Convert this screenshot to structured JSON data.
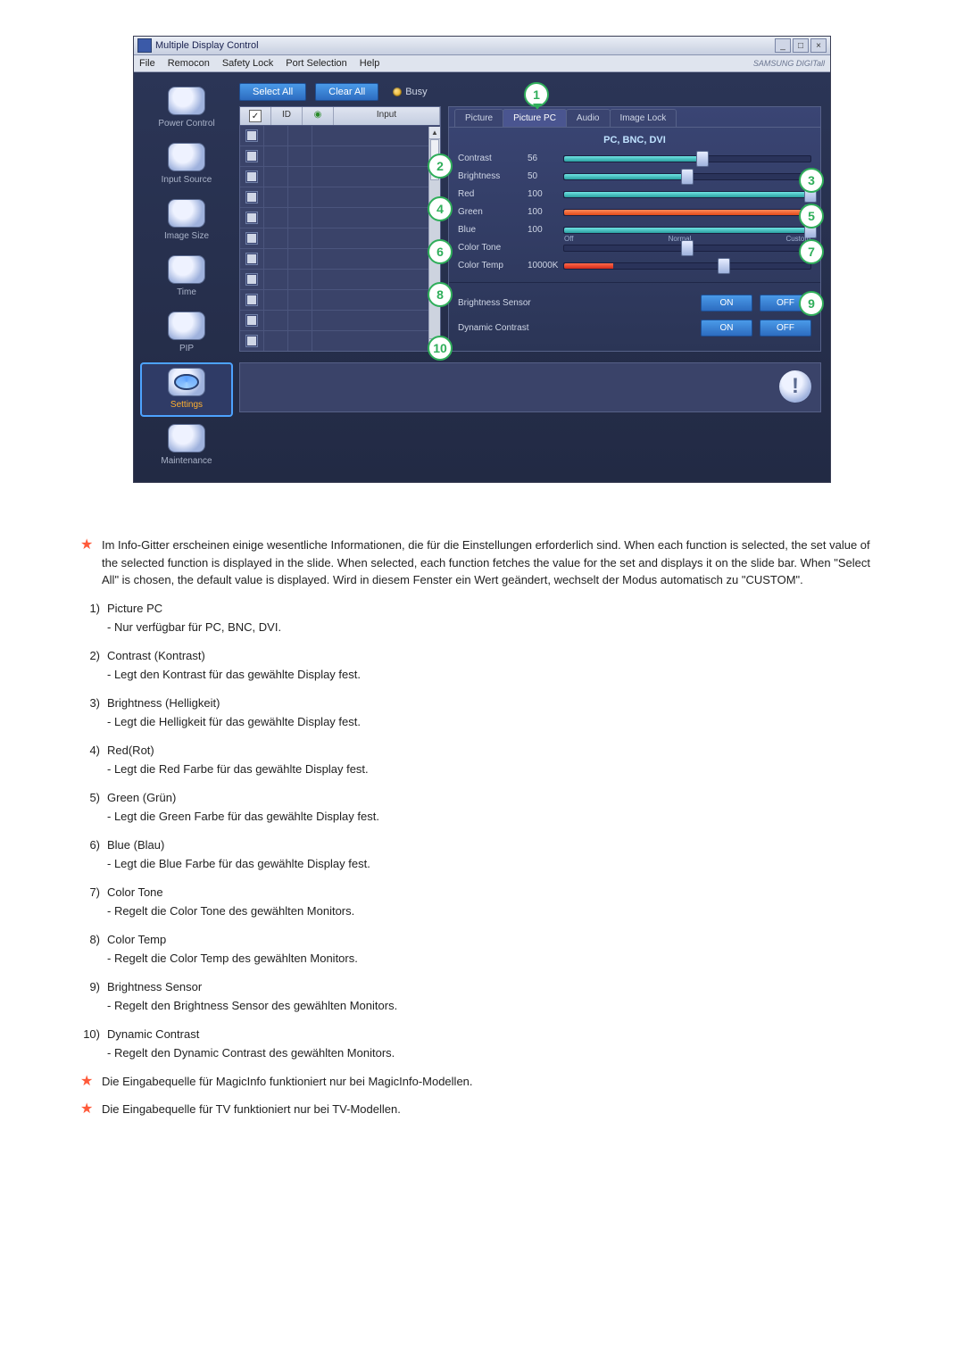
{
  "window": {
    "title": "Multiple Display Control",
    "min_icon": "_",
    "max_icon": "□",
    "close_icon": "×"
  },
  "menubar": {
    "file": "File",
    "remocon": "Remocon",
    "safety_lock": "Safety Lock",
    "port_selection": "Port Selection",
    "help": "Help",
    "brand": "SAMSUNG DIGITall"
  },
  "sidebar": {
    "items": [
      {
        "label": "Power Control"
      },
      {
        "label": "Input Source"
      },
      {
        "label": "Image Size"
      },
      {
        "label": "Time"
      },
      {
        "label": "PIP"
      },
      {
        "label": "Settings"
      },
      {
        "label": "Maintenance"
      }
    ]
  },
  "toolbar": {
    "select_all": "Select All",
    "clear_all": "Clear All",
    "busy": "Busy"
  },
  "grid": {
    "head_check": "✓",
    "head_id": "ID",
    "head_icon": "◉",
    "head_input": "Input",
    "row_count": 11
  },
  "panel": {
    "tabs": {
      "picture": "Picture",
      "picture_pc": "Picture PC",
      "audio": "Audio",
      "image_lock": "Image Lock"
    },
    "mode": "PC, BNC, DVI",
    "contrast": {
      "label": "Contrast",
      "value": "56"
    },
    "brightness": {
      "label": "Brightness",
      "value": "50"
    },
    "red": {
      "label": "Red",
      "value": "100"
    },
    "green": {
      "label": "Green",
      "value": "100"
    },
    "blue": {
      "label": "Blue",
      "value": "100"
    },
    "color_tone": {
      "label": "Color Tone",
      "ticks": {
        "off": "Off",
        "normal": "Normal",
        "custom": "Custom"
      }
    },
    "color_temp": {
      "label": "Color Temp",
      "value": "10000K"
    },
    "bsensor": {
      "label": "Brightness Sensor",
      "on": "ON",
      "off": "OFF"
    },
    "dcontrast": {
      "label": "Dynamic Contrast",
      "on": "ON",
      "off": "OFF"
    }
  },
  "callouts": {
    "c1": "1",
    "c2": "2",
    "c3": "3",
    "c4": "4",
    "c5": "5",
    "c6": "6",
    "c7": "7",
    "c8": "8",
    "c9": "9",
    "c10": "10"
  },
  "warn_glyph": "!",
  "doc": {
    "intro": "Im Info-Gitter erscheinen einige wesentliche Informationen, die für die Einstellungen erforderlich sind. When each function is selected, the set value of the selected function is displayed in the slide. When selected, each function fetches the value for the set and displays it on the slide bar. When \"Select All\" is chosen, the default value is displayed. Wird in diesem Fenster ein Wert geändert, wechselt der Modus automatisch zu \"CUSTOM\".",
    "i1_n": "1)",
    "i1_t": "Picture PC",
    "i1_s": "- Nur verfügbar für PC, BNC, DVI.",
    "i2_n": "2)",
    "i2_t": "Contrast (Kontrast)",
    "i2_s": "- Legt den Kontrast für das gewählte Display fest.",
    "i3_n": "3)",
    "i3_t": "Brightness (Helligkeit)",
    "i3_s": "- Legt die Helligkeit für das gewählte Display fest.",
    "i4_n": "4)",
    "i4_t": "Red(Rot)",
    "i4_s": "- Legt die Red Farbe für das gewählte Display fest.",
    "i5_n": "5)",
    "i5_t": "Green (Grün)",
    "i5_s": "- Legt die Green Farbe für das gewählte Display fest.",
    "i6_n": "6)",
    "i6_t": "Blue (Blau)",
    "i6_s": "- Legt die Blue Farbe für das gewählte Display fest.",
    "i7_n": "7)",
    "i7_t": "Color Tone",
    "i7_s": "- Regelt die Color Tone des gewählten Monitors.",
    "i8_n": "8)",
    "i8_t": "Color Temp",
    "i8_s": "- Regelt die Color Temp des gewählten Monitors.",
    "i9_n": "9)",
    "i9_t": "Brightness Sensor",
    "i9_s": "- Regelt den Brightness Sensor des gewählten Monitors.",
    "i10_n": "10)",
    "i10_t": "Dynamic Contrast",
    "i10_s": "- Regelt den Dynamic Contrast des gewählten Monitors.",
    "note_magicinfo": "Die Eingabequelle für MagicInfo funktioniert nur bei MagicInfo-Modellen.",
    "note_tv": "Die Eingabequelle für TV funktioniert nur bei TV-Modellen."
  }
}
